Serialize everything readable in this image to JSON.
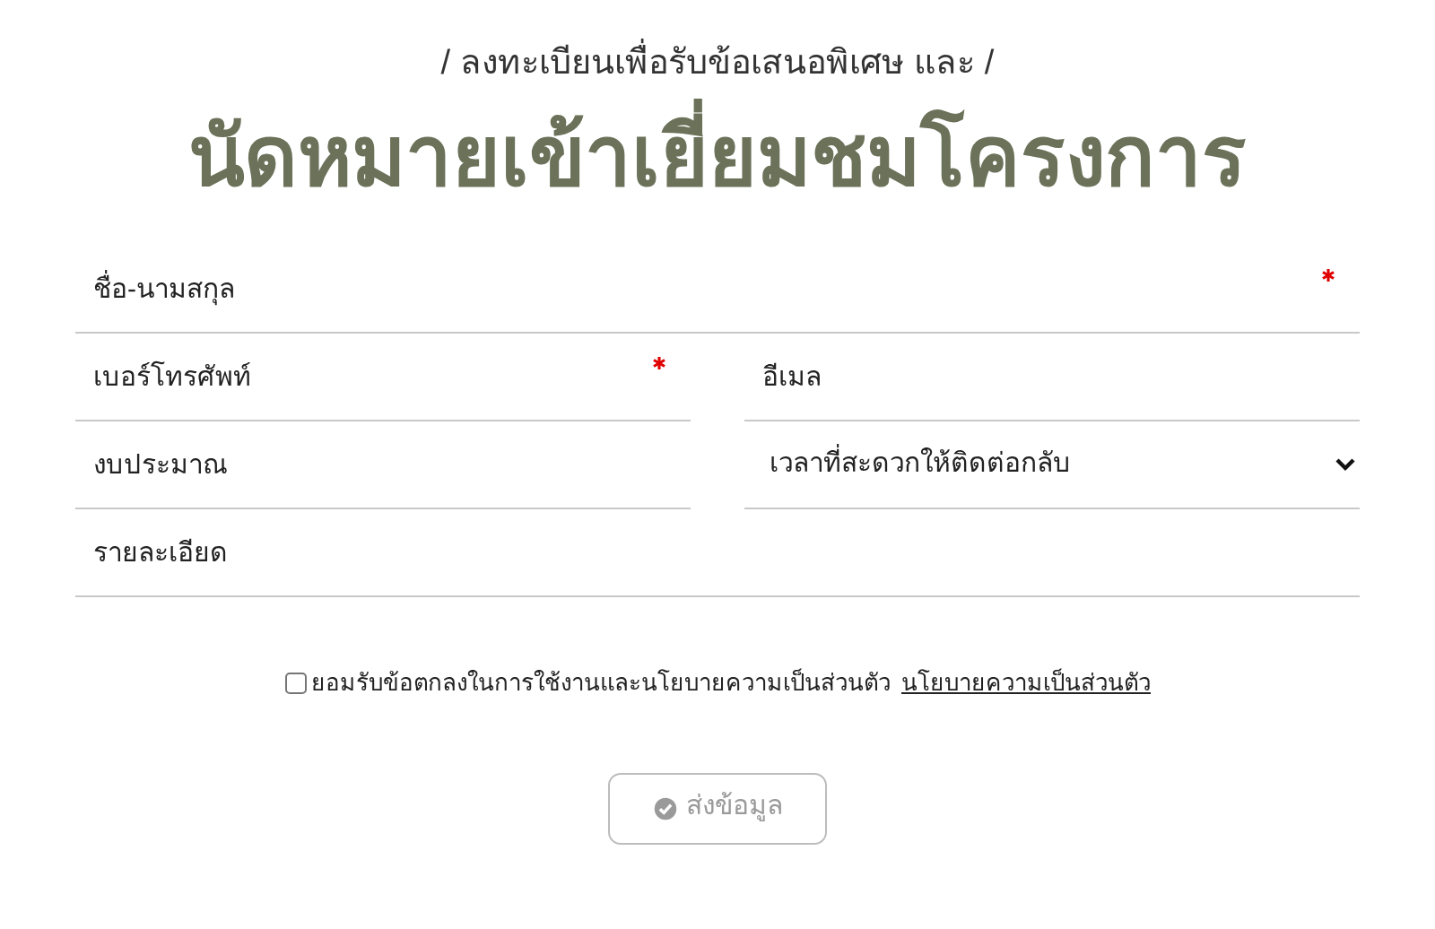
{
  "subtitle": "/ ลงทะเบียนเพื่อรับข้อเสนอพิเศษ และ /",
  "title": "นัดหมายเข้าเยี่ยมชมโครงการ",
  "form_rows": [
    [
      {
        "kind": "input",
        "placeholder": "ชื่อ-นามสกุล",
        "required": true
      }
    ],
    [
      {
        "kind": "input",
        "placeholder": "เบอร์โทรศัพท์",
        "required": true
      },
      {
        "kind": "input",
        "placeholder": "อีเมล",
        "required": false
      }
    ],
    [
      {
        "kind": "input",
        "placeholder": "งบประมาณ",
        "required": false
      },
      {
        "kind": "select",
        "placeholder": "เวลาที่สะดวกให้ติดต่อกลับ",
        "required": false
      }
    ],
    [
      {
        "kind": "input",
        "placeholder": "รายละเอียด",
        "required": false
      }
    ]
  ],
  "consent": {
    "checked": false,
    "label": "ยอมรับข้อตกลงในการใช้งานและนโยบายความเป็นส่วนตัว",
    "link": "นโยบายความเป็นส่วนตัว"
  },
  "submit": {
    "label": "ส่งข้อมูล",
    "disabled": true
  }
}
